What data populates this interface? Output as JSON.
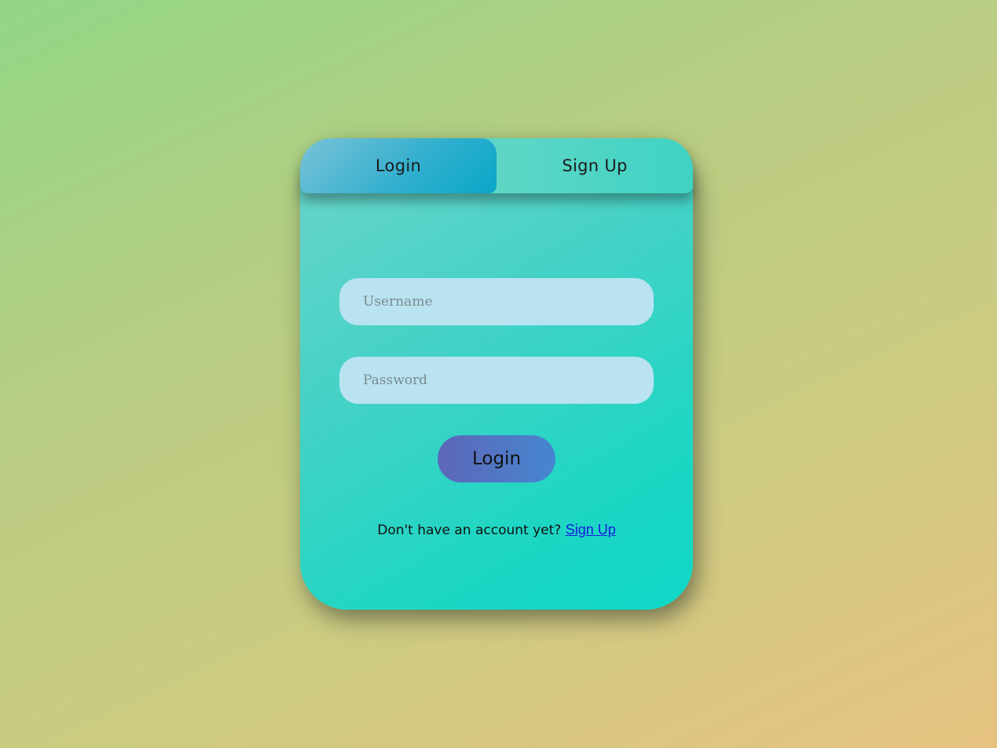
{
  "tabs": {
    "login_label": "Login",
    "signup_label": "Sign Up"
  },
  "form": {
    "username_placeholder": "Username",
    "password_placeholder": "Password",
    "submit_label": "Login"
  },
  "footer": {
    "prompt_text": "Don't have an account yet?",
    "signup_link": "Sign Up"
  },
  "colors": {
    "card_accent": "#1ed6c4",
    "active_tab": "#34b0cf",
    "button": "#4f76c4",
    "input_fill": "#b9e3f1",
    "link": "#1a1ae0"
  }
}
